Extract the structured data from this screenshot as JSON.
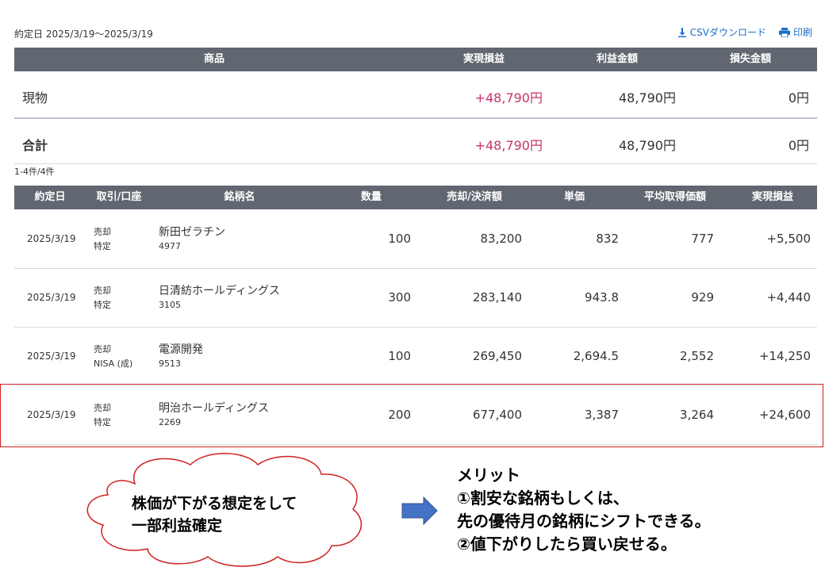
{
  "header": {
    "period": "約定日 2025/3/19〜2025/3/19",
    "csv_label": "CSVダウンロード",
    "print_label": "印刷"
  },
  "summary": {
    "columns": [
      "商品",
      "実現損益",
      "利益金額",
      "損失金額"
    ],
    "rows": [
      {
        "product": "現物",
        "realized": "+48,790円",
        "profit": "48,790円",
        "loss": "0円"
      }
    ],
    "total": {
      "product": "合計",
      "realized": "+48,790円",
      "profit": "48,790円",
      "loss": "0円"
    }
  },
  "count_label": "1-4件/4件",
  "detail": {
    "columns": [
      "約定日",
      "取引/口座",
      "銘柄名",
      "数量",
      "売却/決済額",
      "単価",
      "平均取得価額",
      "実現損益"
    ],
    "rows": [
      {
        "date": "2025/3/19",
        "trade": "売却",
        "account": "特定",
        "name": "新田ゼラチン",
        "code": "4977",
        "qty": "100",
        "amount": "83,200",
        "price": "832",
        "avg": "777",
        "pl": "+5,500"
      },
      {
        "date": "2025/3/19",
        "trade": "売却",
        "account": "特定",
        "name": "日清紡ホールディングス",
        "code": "3105",
        "qty": "300",
        "amount": "283,140",
        "price": "943.8",
        "avg": "929",
        "pl": "+4,440"
      },
      {
        "date": "2025/3/19",
        "trade": "売却",
        "account": "NISA (成)",
        "name": "電源開発",
        "code": "9513",
        "qty": "100",
        "amount": "269,450",
        "price": "2,694.5",
        "avg": "2,552",
        "pl": "+14,250"
      },
      {
        "date": "2025/3/19",
        "trade": "売却",
        "account": "特定",
        "name": "明治ホールディングス",
        "code": "2269",
        "qty": "200",
        "amount": "677,400",
        "price": "3,387",
        "avg": "3,264",
        "pl": "+24,600"
      }
    ]
  },
  "annotation": {
    "cloud_line1": "株価が下がる想定をして",
    "cloud_line2": "一部利益確定",
    "merit_title": "メリット",
    "merit_line1": "①割安な銘柄もしくは、",
    "merit_line2": "先の優待月の銘柄にシフトできる。",
    "merit_line3": "②値下がりしたら買い戻せる。"
  },
  "colors": {
    "header_bg": "#616771",
    "positive": "#c8336e",
    "link": "#1a6ec8",
    "highlight_border": "#d02020",
    "arrow_fill": "#4472c4"
  },
  "icons": {
    "download": "download-icon",
    "print": "printer-icon"
  }
}
